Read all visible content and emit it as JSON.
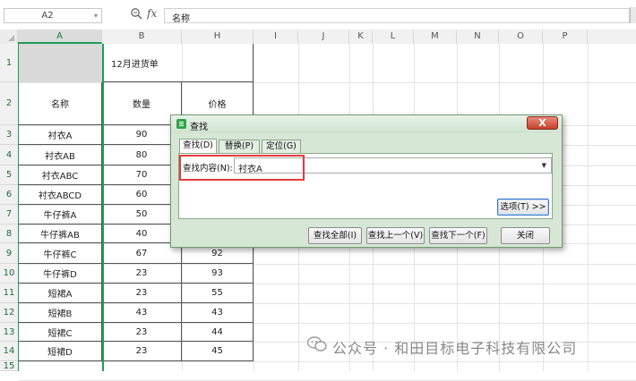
{
  "formula_bar": {
    "name_box": "A2",
    "fx_label": "fx",
    "content": "名称"
  },
  "columns": [
    "A",
    "B",
    "H",
    "I",
    "J",
    "K",
    "L",
    "M",
    "N",
    "O",
    "P"
  ],
  "rows": [
    "1",
    "2",
    "3",
    "4",
    "5",
    "6",
    "7",
    "8",
    "9",
    "10",
    "11",
    "12",
    "13",
    "14",
    "15"
  ],
  "sheet": {
    "title_cell": "12月进货单",
    "headers": {
      "name": "名称",
      "qty": "数量",
      "price": "价格"
    },
    "data_rows": [
      {
        "name": "衬衣A",
        "qty": "90",
        "price": ""
      },
      {
        "name": "衬衣AB",
        "qty": "80",
        "price": ""
      },
      {
        "name": "衬衣ABC",
        "qty": "70",
        "price": ""
      },
      {
        "name": "衬衣ABCD",
        "qty": "60",
        "price": ""
      },
      {
        "name": "牛仔裤A",
        "qty": "50",
        "price": ""
      },
      {
        "name": "牛仔裤AB",
        "qty": "40",
        "price": ""
      },
      {
        "name": "牛仔裤C",
        "qty": "67",
        "price": "92"
      },
      {
        "name": "牛仔裤D",
        "qty": "23",
        "price": "93"
      },
      {
        "name": "短裙A",
        "qty": "23",
        "price": "55"
      },
      {
        "name": "短裙B",
        "qty": "43",
        "price": "43"
      },
      {
        "name": "短裙C",
        "qty": "23",
        "price": "44"
      },
      {
        "name": "短裙D",
        "qty": "23",
        "price": "45"
      }
    ]
  },
  "dialog": {
    "title": "查找",
    "close": "X",
    "tabs": [
      "查找(D)",
      "替换(P)",
      "定位(G)"
    ],
    "find_label": "查找内容(N):",
    "find_value": "衬衣A",
    "options_button": "选项(T) >>",
    "buttons": {
      "find_all": "查找全部(I)",
      "find_prev": "查找上一个(V)",
      "find_next": "查找下一个(F)",
      "close": "关闭"
    }
  },
  "watermark": "公众号 · 和田目标电子科技有限公司",
  "colors": {
    "selection": "#1f9d55",
    "highlight": "#e23c3c",
    "dialog_bg": "#d6e7d6"
  }
}
